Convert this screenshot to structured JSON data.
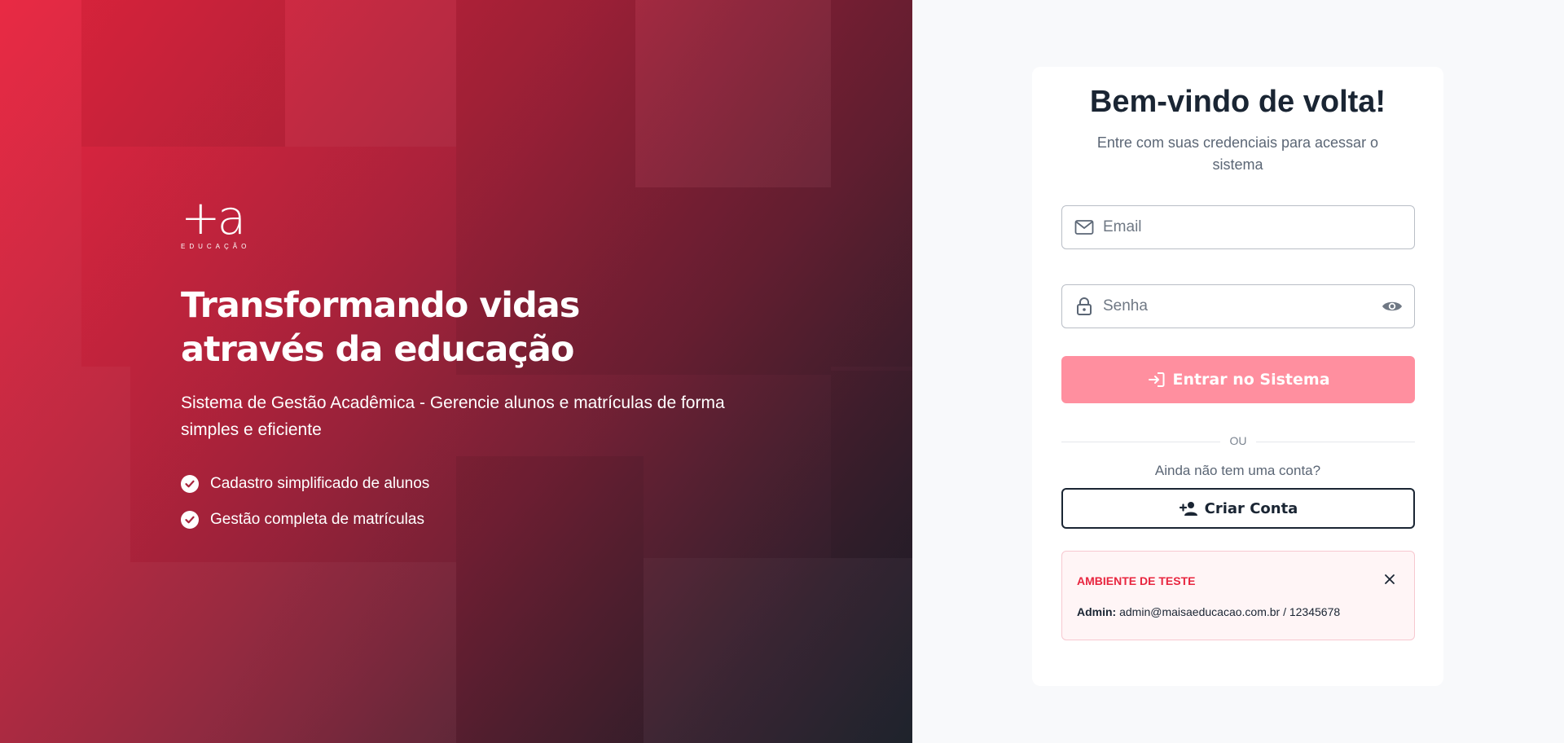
{
  "brand": {
    "logo_mark": "+a",
    "logo_sub": "EDUCAÇÃO",
    "primary_color": "#e8253f",
    "button_color": "#ff8f9f"
  },
  "hero": {
    "title_line1": "Transformando vidas",
    "title_line2": "através da educação",
    "description": "Sistema de Gestão Acadêmica - Gerencie alunos e matrículas de forma simples e eficiente",
    "features": [
      {
        "label": "Cadastro simplificado de alunos",
        "icon": "check-circle-icon"
      },
      {
        "label": "Gestão completa de matrículas",
        "icon": "check-circle-icon"
      }
    ]
  },
  "login": {
    "title": "Bem-vindo de volta!",
    "subtitle": "Entre com suas credenciais para acessar o sistema",
    "email_placeholder": "Email",
    "email_value": "",
    "password_placeholder": "Senha",
    "password_value": "",
    "submit_label": "Entrar no Sistema",
    "divider_label": "OU",
    "no_account_text": "Ainda não tem uma conta?",
    "create_account_label": "Criar Conta"
  },
  "notice": {
    "title": "AMBIENTE DE TESTE",
    "admin_label": "Admin:",
    "admin_credentials": "admin@maisaeducacao.com.br / 12345678"
  }
}
